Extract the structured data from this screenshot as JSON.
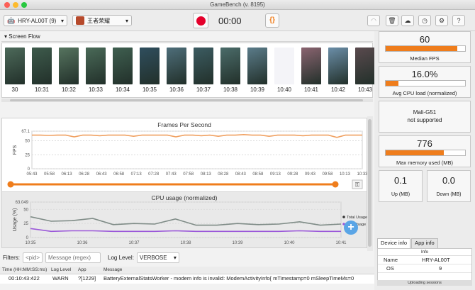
{
  "window": {
    "title": "GameBench (v. 8195)"
  },
  "toolbar": {
    "device": "HRY-AL00T (9)",
    "app": "王者荣耀",
    "timer": "00:00",
    "brace_label": "{}"
  },
  "screen_flow": {
    "label": "Screen Flow",
    "times": [
      "30",
      "10:31",
      "10:32",
      "10:33",
      "10:34",
      "10:35",
      "10:36",
      "10:37",
      "10:38",
      "10:39",
      "10:40",
      "10:41",
      "10:42",
      "10:43"
    ]
  },
  "fps_chart": {
    "title": "Frames Per Second",
    "ylabel": "FPS"
  },
  "cpu_chart": {
    "title": "CPU usage (normalized)",
    "ylabel": "Usage (%)",
    "legend_total": "Total Usage",
    "legend_app": "App Usage"
  },
  "chart_data": [
    {
      "type": "line",
      "title": "Frames Per Second",
      "ylabel": "FPS",
      "x_ticks": [
        "05:43",
        "05:58",
        "06:13",
        "06:28",
        "06:43",
        "06:58",
        "07:13",
        "07:28",
        "07:43",
        "07:58",
        "08:13",
        "08:28",
        "08:43",
        "08:58",
        "09:13",
        "09:28",
        "09:43",
        "09:58",
        "10:13",
        "10:33"
      ],
      "y_ticks": [
        "67.1",
        "50",
        "25",
        "0"
      ],
      "ylim": [
        0,
        67.1
      ],
      "series": [
        {
          "name": "FPS",
          "color": "#f0a060",
          "values": [
            60,
            60,
            59.5,
            60,
            60,
            57,
            60,
            60,
            59,
            60,
            60,
            60,
            58,
            60,
            60,
            60,
            60,
            57,
            60,
            60,
            59,
            60,
            58,
            60,
            60,
            61,
            60,
            60,
            58,
            60,
            60,
            60,
            59,
            60,
            60,
            60,
            56,
            60,
            60,
            60
          ]
        }
      ]
    },
    {
      "type": "line",
      "title": "CPU usage (normalized)",
      "ylabel": "Usage (%)",
      "x_ticks": [
        "10:35",
        "10:36",
        "10:37",
        "10:38",
        "10:39",
        "10:40",
        "10:41"
      ],
      "y_ticks": [
        "63.049",
        "50",
        "25",
        "0"
      ],
      "ylim": [
        0,
        63.049
      ],
      "series": [
        {
          "name": "Total Usage",
          "color": "#7f8c87",
          "values": [
            37,
            29,
            30,
            34,
            23,
            25,
            24,
            33,
            22,
            22,
            25,
            23,
            24,
            28,
            22,
            24
          ]
        },
        {
          "name": "App Usage",
          "color": "#9b59d9",
          "values": [
            16,
            11,
            12,
            12,
            11,
            11,
            11,
            12,
            11,
            11,
            11,
            11,
            11,
            12,
            11,
            11
          ]
        }
      ]
    }
  ],
  "filters": {
    "label": "Filters:",
    "pid_placeholder": "<pid>",
    "msg_placeholder": "Message (regex)",
    "loglevel_label": "Log Level:",
    "loglevel_value": "VERBOSE"
  },
  "log": {
    "columns": [
      "Time (HH:MM:SS:ms)",
      "Log Level",
      "App",
      "Message"
    ],
    "rows": [
      [
        "00:10:43:422",
        "WARN",
        "?[1229]",
        "BatteryExternalStatsWorker - modem info is invalid: ModemActivityInfo{ mTimestamp=0 mSleepTimeMs=0"
      ]
    ]
  },
  "metrics": {
    "median_fps": {
      "value": "60",
      "label": "Median FPS",
      "fill": 0.9
    },
    "cpu_load": {
      "value": "16.0%",
      "label": "Avg CPU load (normalized)",
      "fill": 0.16
    },
    "gpu": {
      "line1": "Mali-G51",
      "line2": "not supported"
    },
    "memory": {
      "value": "776",
      "label": "Max memory used (MB)",
      "fill": 0.73
    },
    "up": {
      "value": "0.1",
      "label": "Up (MB)"
    },
    "down": {
      "value": "0.0",
      "label": "Down (MB)"
    }
  },
  "device_info": {
    "tabs": [
      "Device info",
      "App info"
    ],
    "header": "Info",
    "rows": [
      [
        "Name",
        "HRY-AL00T"
      ],
      [
        "OS",
        "9"
      ]
    ],
    "upload": "Uploading sessions"
  },
  "colors": {
    "accent": "#ef7d1c",
    "record": "#e4002b"
  }
}
